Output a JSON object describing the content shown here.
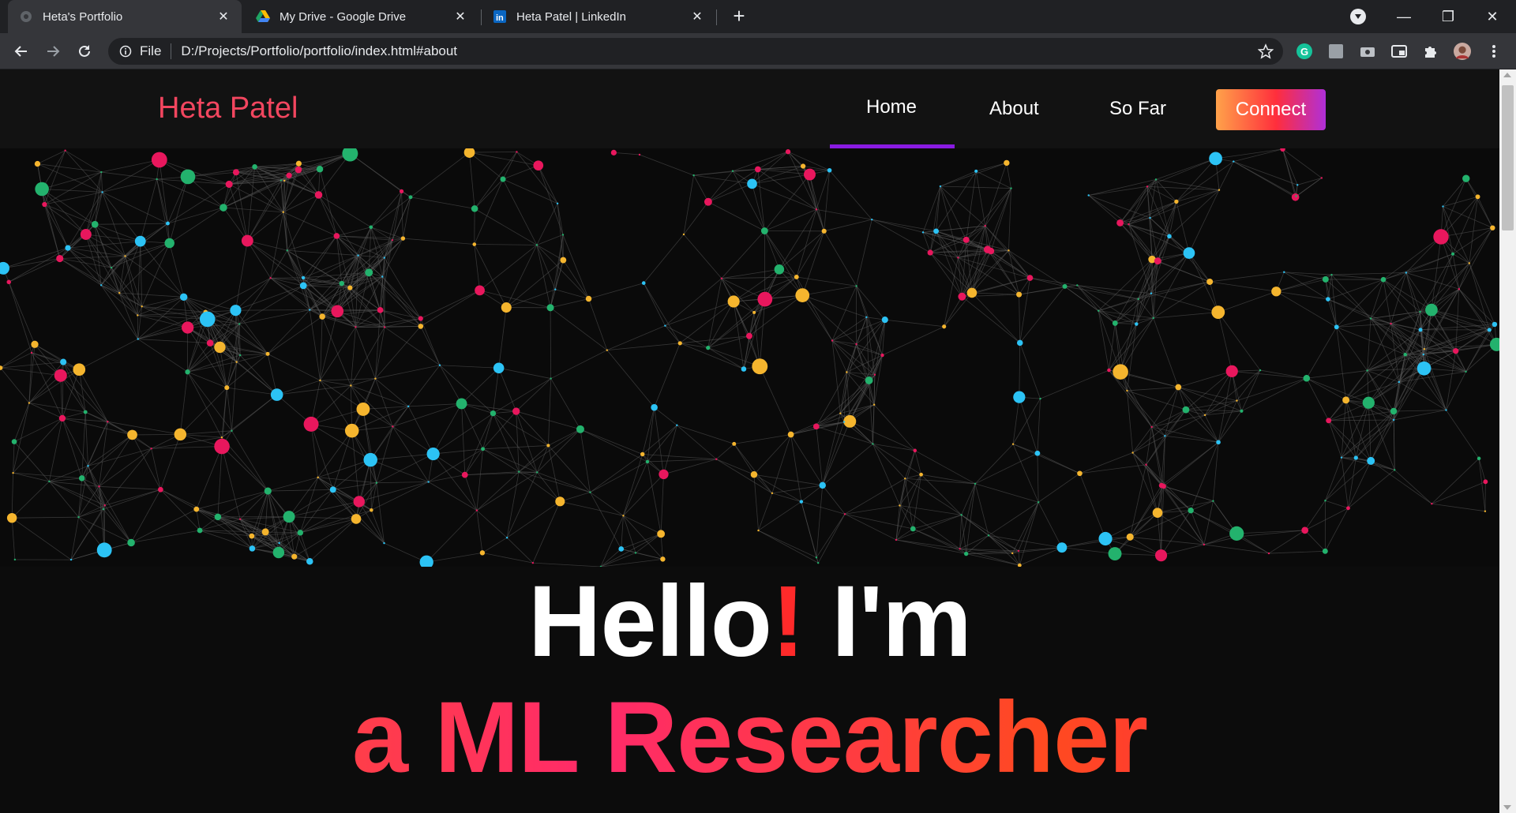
{
  "browser": {
    "tabs": [
      {
        "title": "Heta's Portfolio",
        "active": true,
        "icon": "globe-icon"
      },
      {
        "title": "My Drive - Google Drive",
        "active": false,
        "icon": "google-drive-icon"
      },
      {
        "title": "Heta Patel | LinkedIn",
        "active": false,
        "icon": "linkedin-icon"
      }
    ],
    "address": {
      "scheme": "File",
      "url": "D:/Projects/Portfolio/portfolio/index.html#about"
    }
  },
  "site": {
    "brand": "Heta Patel",
    "nav": {
      "home": "Home",
      "about": "About",
      "so_far": "So Far",
      "connect": "Connect",
      "active": "Home"
    },
    "hero": {
      "hello": "Hello",
      "exclaim": "!",
      "im": " I'm",
      "role": "a ML Researcher"
    }
  },
  "colors": {
    "brand": "#f2465f",
    "accent": "#8a1be2",
    "node_red": "#e8175d",
    "node_yellow": "#f5b52e",
    "node_blue": "#2cc3f5",
    "node_green": "#23b26d"
  }
}
